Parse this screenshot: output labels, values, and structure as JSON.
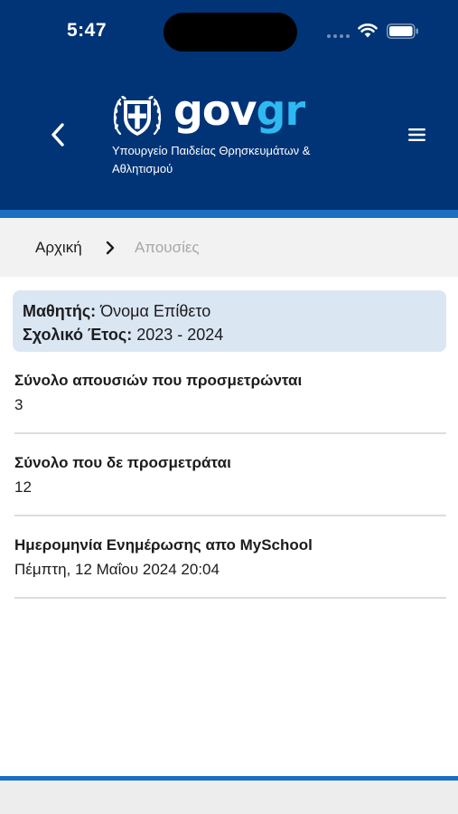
{
  "status_bar": {
    "time": "5:47"
  },
  "header": {
    "brand_gov": "gov",
    "brand_gr": "gr",
    "ministry_line1": "Υπουργείο Παιδείας Θρησκευμάτων &",
    "ministry_line2": "Αθλητισμού",
    "colors": {
      "background": "#003476",
      "accent": "#1b6fc2",
      "brand_gr": "#2fb9f1"
    },
    "icons": {
      "back": "chevron-left-icon",
      "menu": "hamburger-menu-icon",
      "emblem": "greek-coat-of-arms-icon"
    }
  },
  "breadcrumb": {
    "home_label": "Αρχική",
    "current_label": "Απουσίες"
  },
  "student_card": {
    "student_label": "Μαθητής:",
    "student_name": "Όνομα Επίθετο",
    "year_label": "Σχολικό Έτος:",
    "year_value": "2023 - 2024"
  },
  "stats": [
    {
      "title": "Σύνολο απουσιών που προσμετρώνται",
      "value": "3"
    },
    {
      "title": "Σύνολο που δε προσμετράται",
      "value": "12"
    },
    {
      "title": "Ημερομηνία Ενημέρωσης απο MySchool",
      "value": "Πέμπτη, 12 Μαΐου 2024 20:04"
    }
  ]
}
